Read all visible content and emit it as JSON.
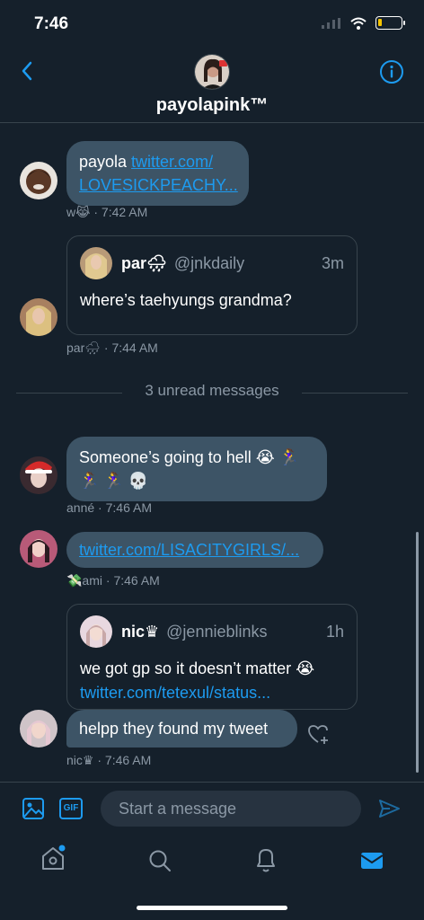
{
  "status": {
    "time": "7:46"
  },
  "header": {
    "title": "payolapink™"
  },
  "messages": [
    {
      "text": "payola ",
      "link": "twitter.com/",
      "link2": "LOVESICKPEACHY...",
      "sender": "w😹",
      "time": "7:42 AM"
    },
    {
      "quote": {
        "name": "par🌧",
        "handle": "@jnkdaily",
        "time": "3m",
        "text": "where’s taehyungs grandma?"
      },
      "sender": "par🌧",
      "time": "7:44 AM"
    },
    {
      "text": "Someone’s going to hell 😭 🏃‍♀️",
      "text2": "🏃‍♀️ 🏃‍♀️ 💀",
      "sender": "anné",
      "time": "7:46 AM"
    },
    {
      "link": "twitter.com/LISACITYGIRLS/...",
      "sender": "💸ami",
      "time": "7:46 AM"
    },
    {
      "quote": {
        "name": "nic♛",
        "handle": "@jennieblinks",
        "time": "1h",
        "text": "we got gp so it doesn’t matter 😭",
        "link": "twitter.com/tetexul/status..."
      },
      "text": "helpp they found my tweet",
      "sender": "nic♛",
      "time": "7:46 AM"
    }
  ],
  "unread": "3 unread messages",
  "composer": {
    "placeholder": "Start a message",
    "gif": "GIF"
  },
  "colors": {
    "background": "#15202b",
    "bubble": "#3d5466",
    "accent": "#1d9bf0",
    "muted": "#8b98a5"
  }
}
